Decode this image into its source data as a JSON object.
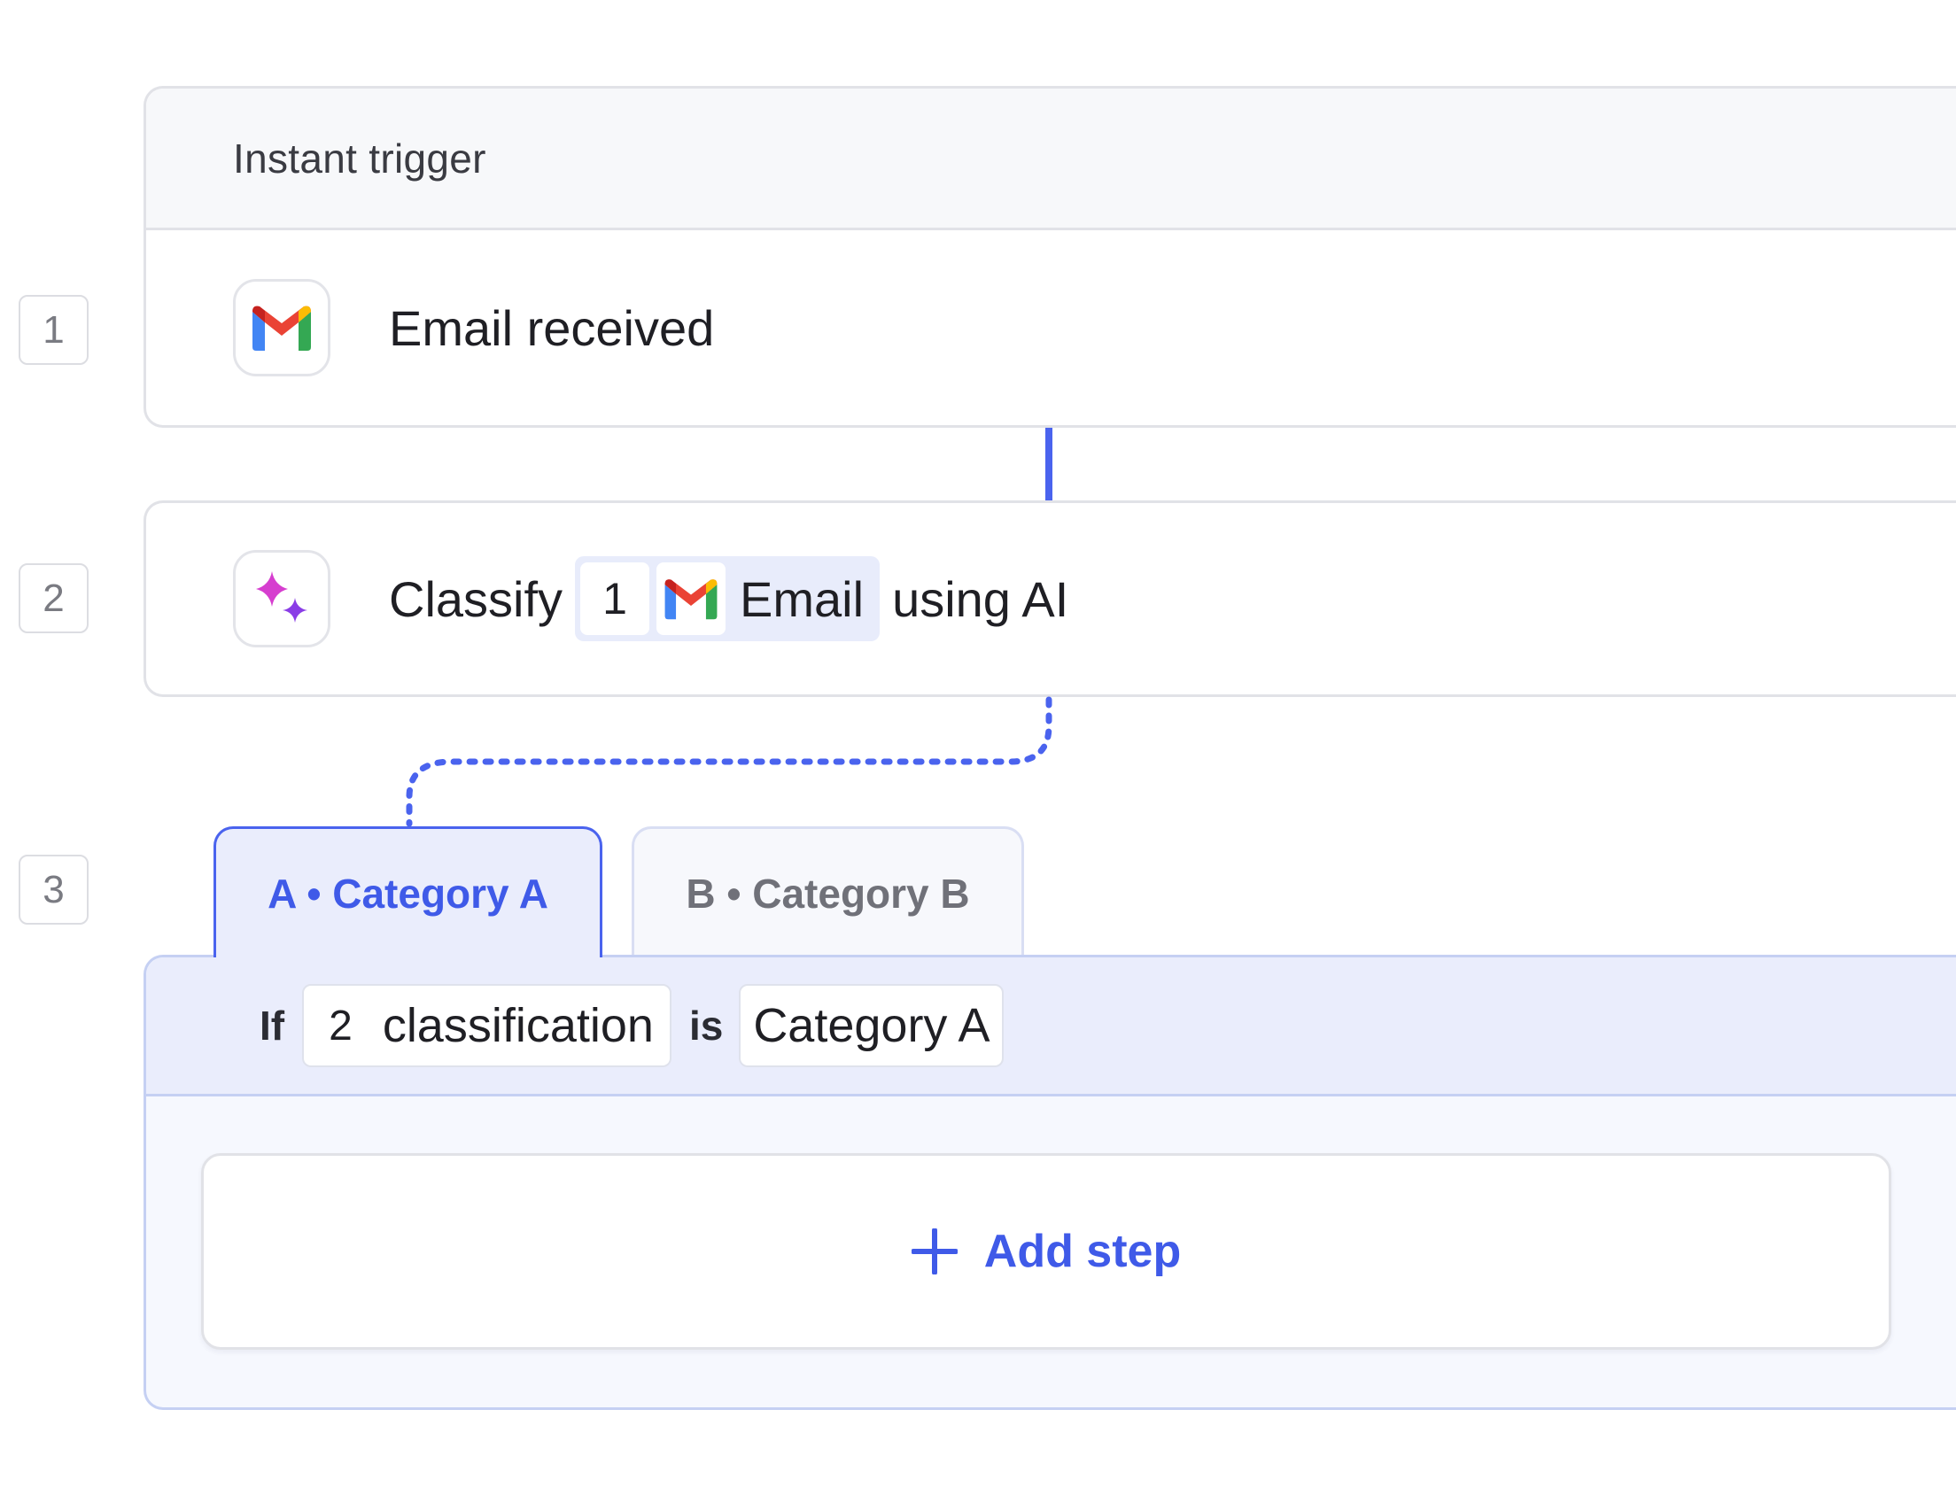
{
  "steps": [
    {
      "number": "1",
      "header": "Instant trigger",
      "icon": "gmail-icon",
      "title": "Email received"
    },
    {
      "number": "2",
      "icon": "ai-sparkle-icon",
      "prefix": "Classify",
      "reference": {
        "step": "1",
        "icon": "gmail-icon",
        "label": "Email"
      },
      "suffix": "using AI"
    },
    {
      "number": "3",
      "tabs": [
        {
          "label": "A • Category A",
          "active": true
        },
        {
          "label": "B • Category B",
          "active": false
        }
      ],
      "condition": {
        "if_label": "If",
        "variable_step": "2",
        "variable_name": "classification",
        "operator": "is",
        "value": "Category A"
      },
      "add_step_label": "Add step"
    }
  ],
  "colors": {
    "accent": "#4a63ee",
    "accent_text": "#3f5ae8",
    "border": "#e1e2e7",
    "branch_bg": "#eaedfc"
  }
}
